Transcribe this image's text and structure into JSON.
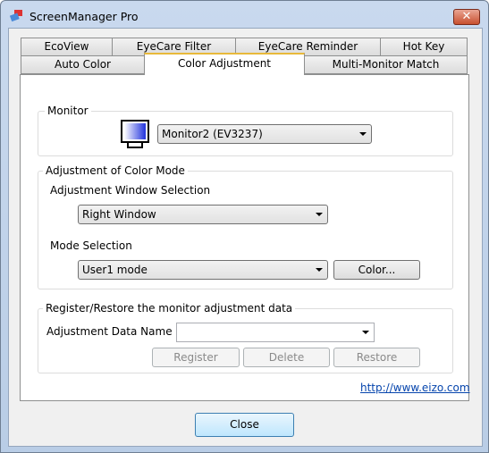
{
  "window": {
    "title": "ScreenManager Pro",
    "close_glyph": "✕"
  },
  "tabs": {
    "row1": [
      "EcoView",
      "EyeCare Filter",
      "EyeCare Reminder",
      "Hot Key"
    ],
    "row2": [
      "Auto Color",
      "Color Adjustment",
      "Multi-Monitor Match"
    ],
    "selected": "Color Adjustment"
  },
  "monitor": {
    "label": "Monitor",
    "value": "Monitor2 (EV3237)"
  },
  "color_mode": {
    "label": "Adjustment of Color Mode",
    "window_selection_label": "Adjustment Window Selection",
    "window_selection_value": "Right Window",
    "mode_label": "Mode Selection",
    "mode_value": "User1 mode",
    "color_button": "Color..."
  },
  "register": {
    "label": "Register/Restore the monitor adjustment data",
    "name_label": "Adjustment Data Name :",
    "name_value": "",
    "register_button": "Register",
    "delete_button": "Delete",
    "restore_button": "Restore"
  },
  "link": "http://www.eizo.com",
  "close_button": "Close"
}
